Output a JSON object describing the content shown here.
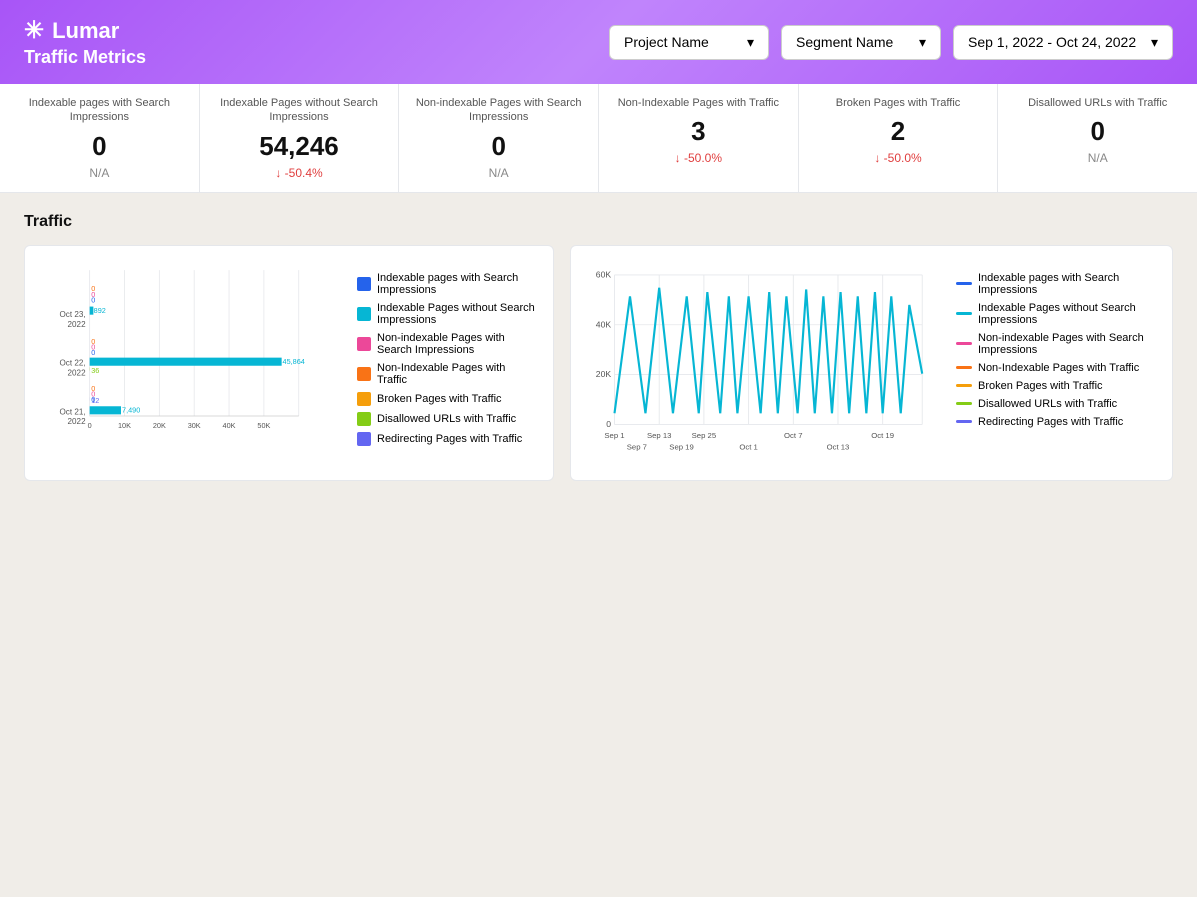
{
  "header": {
    "logo_text": "Lumar",
    "page_title": "Traffic Metrics",
    "project_dropdown": "Project Name",
    "segment_dropdown": "Segment Name",
    "date_range": "Sep 1, 2022 - Oct 24, 2022"
  },
  "metrics": [
    {
      "label": "Indexable pages with Search Impressions",
      "value": "0",
      "change": "N/A",
      "change_type": "neutral"
    },
    {
      "label": "Indexable Pages without Search Impressions",
      "value": "54,246",
      "change": "↓ -50.4%",
      "change_type": "down"
    },
    {
      "label": "Non-indexable Pages with Search Impressions",
      "value": "0",
      "change": "N/A",
      "change_type": "neutral"
    },
    {
      "label": "Non-Indexable Pages with Traffic",
      "value": "3",
      "change": "↓ -50.0%",
      "change_type": "down"
    },
    {
      "label": "Broken Pages with Traffic",
      "value": "2",
      "change": "↓ -50.0%",
      "change_type": "down"
    },
    {
      "label": "Disallowed URLs with Traffic",
      "value": "0",
      "change": "N/A",
      "change_type": "neutral"
    }
  ],
  "traffic_section_title": "Traffic",
  "bar_chart": {
    "dates": [
      "Oct 23, 2022",
      "Oct 22, 2022",
      "Oct 21, 2022"
    ],
    "bars": [
      {
        "date": "Oct 23,\n2022",
        "values": [
          0,
          892,
          0,
          0,
          0,
          0,
          0,
          0
        ]
      },
      {
        "date": "Oct 22,\n2022",
        "values": [
          0,
          45864,
          0,
          0,
          0,
          36,
          0,
          0
        ]
      },
      {
        "date": "Oct 21,\n2022",
        "values": [
          0,
          7490,
          0,
          0,
          0,
          0,
          0,
          12
        ]
      }
    ],
    "x_axis": [
      "0",
      "10K",
      "20K",
      "30K",
      "40K",
      "50K"
    ],
    "max_value": 50000
  },
  "legend_items": [
    {
      "label": "Indexable pages with Search Impressions",
      "color": "#2563eb",
      "type": "box"
    },
    {
      "label": "Indexable Pages without Search Impressions",
      "color": "#06b6d4",
      "type": "box"
    },
    {
      "label": "Non-indexable Pages with Search Impressions",
      "color": "#ec4899",
      "type": "box"
    },
    {
      "label": "Non-Indexable Pages with Traffic",
      "color": "#f97316",
      "type": "box"
    },
    {
      "label": "Broken Pages with Traffic",
      "color": "#f59e0b",
      "type": "box"
    },
    {
      "label": "Disallowed URLs with Traffic",
      "color": "#84cc16",
      "type": "box"
    },
    {
      "label": "Redirecting Pages with Traffic",
      "color": "#6366f1",
      "type": "box"
    }
  ],
  "line_legend_items": [
    {
      "label": "Indexable pages with Search Impressions",
      "color": "#2563eb"
    },
    {
      "label": "Indexable Pages without Search Impressions",
      "color": "#06b6d4"
    },
    {
      "label": "Non-indexable Pages with Search Impressions",
      "color": "#ec4899"
    },
    {
      "label": "Non-Indexable Pages with Traffic",
      "color": "#f97316"
    },
    {
      "label": "Broken Pages with Traffic",
      "color": "#f59e0b"
    },
    {
      "label": "Disallowed URLs with Traffic",
      "color": "#84cc16"
    },
    {
      "label": "Redirecting Pages with Traffic",
      "color": "#6366f1"
    }
  ],
  "line_chart": {
    "y_axis": [
      "60K",
      "40K",
      "20K",
      "0"
    ],
    "x_axis_top": [
      "Sep 1",
      "Sep 13",
      "Sep 25",
      "Oct 7",
      "Oct 19"
    ],
    "x_axis_bottom": [
      "Sep 7",
      "Sep 19",
      "Oct 1",
      "Oct 13"
    ]
  }
}
